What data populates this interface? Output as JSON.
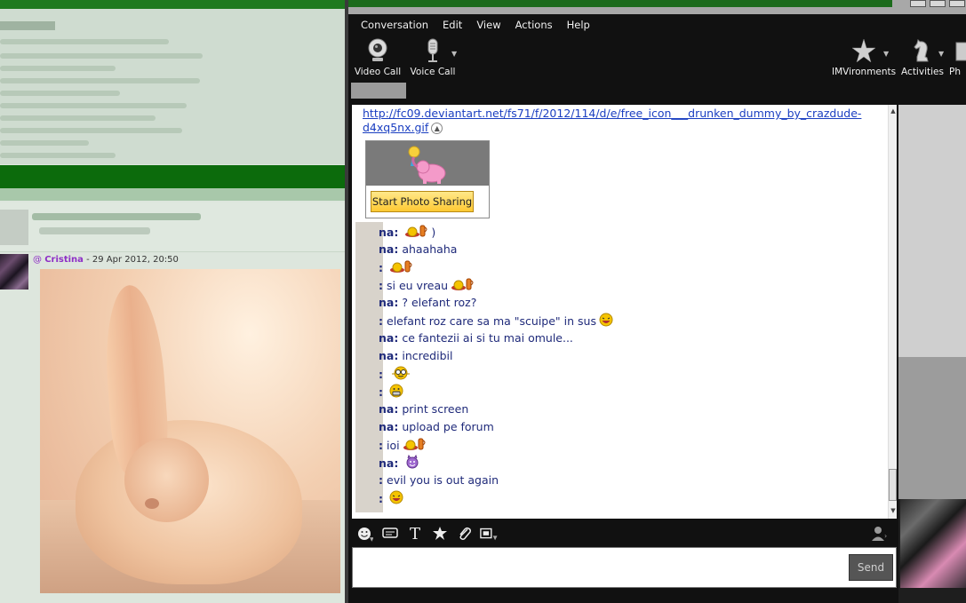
{
  "forum": {
    "post": {
      "username": "Cristina",
      "timestamp": "29 Apr 2012, 20:50"
    }
  },
  "chat": {
    "menu": [
      "Conversation",
      "Edit",
      "View",
      "Actions",
      "Help"
    ],
    "toolbar": {
      "video_call": "Video Call",
      "voice_call": "Voice Call",
      "imvironments": "IMVironments",
      "activities": "Activities",
      "photo_partial": "Ph"
    },
    "link": {
      "line1": "http://fc09.deviantart.net/fs71/f/2012/114/d/e/free_icon___drunken_dummy_by_crazdude-",
      "line2": "d4xq5nx.gif"
    },
    "photo_sharing_button": "Start Photo Sharing",
    "messages": [
      {
        "who": "na:",
        "text": "",
        "tail": ")",
        "emoticon": "drunk-icon"
      },
      {
        "who": "na:",
        "text": "ahaahaha",
        "tail": "",
        "emoticon": ""
      },
      {
        "who": ":",
        "text": "",
        "tail": "",
        "emoticon": "drunk-icon"
      },
      {
        "who": ":",
        "text": "si eu vreau",
        "tail": "",
        "emoticon": "drunk-icon"
      },
      {
        "who": "na:",
        "text": "? elefant roz?",
        "tail": "",
        "emoticon": ""
      },
      {
        "who": ":",
        "text": "elefant roz care sa ma \"scuipe\" in sus",
        "tail": "",
        "emoticon": "laugh-icon"
      },
      {
        "who": "na:",
        "text": "ce fantezii ai si tu mai omule...",
        "tail": "",
        "emoticon": ""
      },
      {
        "who": "na:",
        "text": "incredibil",
        "tail": "",
        "emoticon": ""
      },
      {
        "who": ":",
        "text": "",
        "tail": "",
        "emoticon": "nerd-icon"
      },
      {
        "who": ":",
        "text": "",
        "tail": "",
        "emoticon": "grin-icon"
      },
      {
        "who": "na:",
        "text": "print screen",
        "tail": "",
        "emoticon": ""
      },
      {
        "who": "na:",
        "text": "upload pe forum",
        "tail": "",
        "emoticon": ""
      },
      {
        "who": ":",
        "text": "ioi",
        "tail": "",
        "emoticon": "drunk-icon"
      },
      {
        "who": "na:",
        "text": "",
        "tail": "",
        "emoticon": "devil-icon"
      },
      {
        "who": ":",
        "text": "evil you is out again",
        "tail": "",
        "emoticon": ""
      },
      {
        "who": ":",
        "text": "",
        "tail": "",
        "emoticon": "laugh-icon"
      }
    ],
    "send_label": "Send",
    "format_icons": [
      "smiley-icon",
      "nudge-icon",
      "font-icon",
      "wink-icon",
      "attach-icon",
      "share-icon"
    ]
  }
}
